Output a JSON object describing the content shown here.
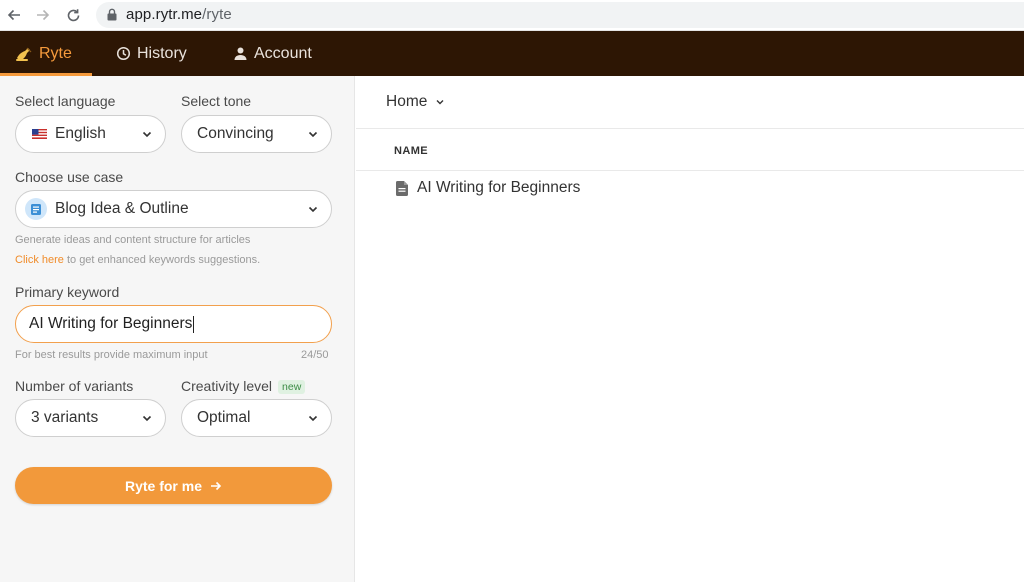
{
  "browser": {
    "url_host": "app.rytr.me",
    "url_path": "/ryte"
  },
  "header": {
    "tabs": [
      {
        "label": "Ryte",
        "icon": "writing-hand-icon",
        "active": true
      },
      {
        "label": "History",
        "icon": "history-icon",
        "active": false
      },
      {
        "label": "Account",
        "icon": "person-icon",
        "active": false
      }
    ],
    "background": "#2d1604",
    "accent": "#f59a3c"
  },
  "sidebar": {
    "language": {
      "label": "Select language",
      "value": "English",
      "flag_icon": "us-flag-icon"
    },
    "tone": {
      "label": "Select tone",
      "value": "Convincing"
    },
    "use_case": {
      "label": "Choose use case",
      "value": "Blog Idea & Outline",
      "description": "Generate ideas and content structure for articles",
      "link_text": "Click here",
      "link_suffix": " to get enhanced keywords suggestions."
    },
    "keyword": {
      "label": "Primary keyword",
      "value": "AI Writing for Beginners",
      "hint": "For best results provide maximum input",
      "counter": "24/50"
    },
    "variants": {
      "label": "Number of variants",
      "value": "3 variants"
    },
    "creativity": {
      "label": "Creativity level",
      "badge": "new",
      "value": "Optimal"
    },
    "submit_label": "Ryte for me"
  },
  "main": {
    "breadcrumb": "Home",
    "column_header": "NAME",
    "documents": [
      {
        "name": "AI Writing for Beginners",
        "icon": "document-icon"
      }
    ]
  }
}
